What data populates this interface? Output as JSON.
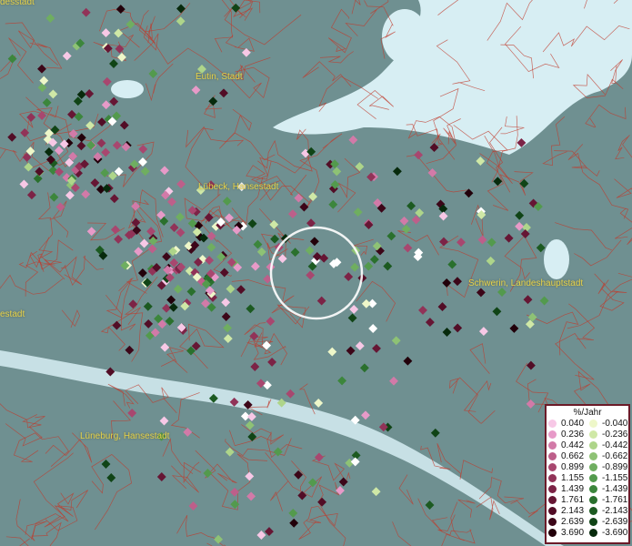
{
  "map": {
    "places": [
      {
        "label": "Eutin, Stadt",
        "id": "eutin"
      },
      {
        "label": "Lübeck, Hansestadt",
        "id": "luebeck"
      },
      {
        "label": "Schwerin, Landeshauptstadt",
        "id": "schwerin"
      },
      {
        "label": "Lüneburg, Hansestadt",
        "id": "lueneburg"
      },
      {
        "label": "desstadt",
        "id": "edge-top"
      },
      {
        "label": "estadt",
        "id": "edge-left"
      }
    ],
    "water_color": "#d7eef3",
    "land_color": "#6f9091",
    "border_color": "#c0392b",
    "highlight_circle_color": "#ffffff"
  },
  "legend": {
    "title": "%/Jahr",
    "positive": {
      "values": [
        "0.040",
        "0.236",
        "0.442",
        "0.662",
        "0.899",
        "1.155",
        "1.439",
        "1.761",
        "2.143",
        "2.639",
        "3.690"
      ],
      "colors": [
        "#f7c8e6",
        "#e79ac8",
        "#d27aa8",
        "#bd5f8a",
        "#a8476f",
        "#913358",
        "#7c2346",
        "#661634",
        "#520d26",
        "#3c0618",
        "#22000a"
      ]
    },
    "negative": {
      "values": [
        "-0.040",
        "-0.236",
        "-0.442",
        "-0.662",
        "-0.899",
        "-1.155",
        "-1.439",
        "-1.761",
        "-2.143",
        "-2.639",
        "-3.690"
      ],
      "colors": [
        "#eef7c9",
        "#cfe8a6",
        "#aed58a",
        "#8ec275",
        "#6fae60",
        "#539a4d",
        "#3c863c",
        "#2a702d",
        "#1c5a21",
        "#104416",
        "#072a0c"
      ]
    }
  }
}
